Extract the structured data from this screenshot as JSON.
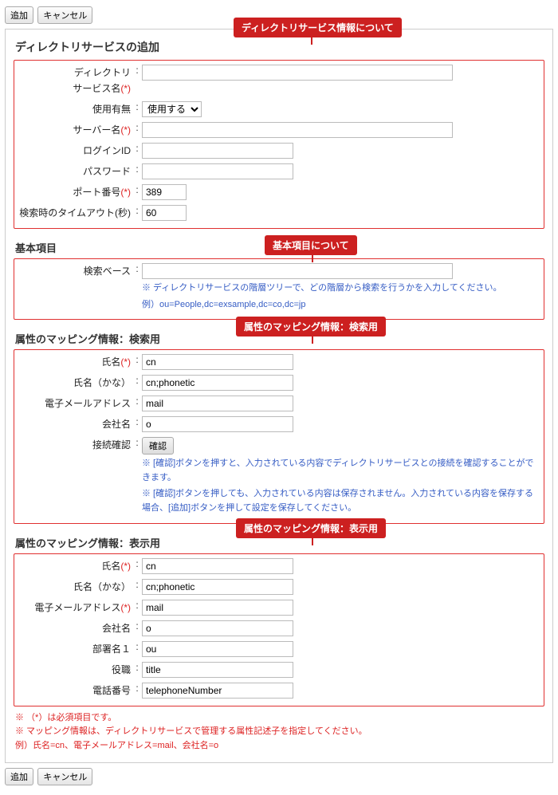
{
  "buttons": {
    "add": "追加",
    "cancel": "キャンセル",
    "confirm": "確認"
  },
  "page_title": "ディレクトリサービスの追加",
  "callouts": {
    "c1": "ディレクトリサービス情報について",
    "c2": "基本項目について",
    "c3": "属性のマッピング情報：検索用",
    "c4": "属性のマッピング情報：表示用"
  },
  "section1": {
    "labels": {
      "dir_name_line1": "ディレクトリ",
      "dir_name_line2": "サービス名",
      "use": "使用有無",
      "server": "サーバー名",
      "login": "ログインID",
      "password": "パスワード",
      "port": "ポート番号",
      "timeout": "検索時のタイムアウト(秒)"
    },
    "values": {
      "dir_name": "",
      "use_selected": "使用する",
      "server": "",
      "login": "",
      "password": "",
      "port": "389",
      "timeout": "60"
    }
  },
  "section2": {
    "title": "基本項目",
    "labels": {
      "base": "検索ベース"
    },
    "values": {
      "base": ""
    },
    "help1": "※ ディレクトリサービスの階層ツリーで、どの階層から検索を行うかを入力してください。",
    "help2": "例）ou=People,dc=exsample,dc=co,dc=jp"
  },
  "section3": {
    "title": "属性のマッピング情報：検索用",
    "labels": {
      "name": "氏名",
      "kana": "氏名（かな）",
      "email": "電子メールアドレス",
      "company": "会社名",
      "conn": "接続確認"
    },
    "values": {
      "name": "cn",
      "kana": "cn;phonetic",
      "email": "mail",
      "company": "o"
    },
    "help1": "※ [確認]ボタンを押すと、入力されている内容でディレクトリサービスとの接続を確認することができます。",
    "help2": "※ [確認]ボタンを押しても、入力されている内容は保存されません。入力されている内容を保存する場合、[追加]ボタンを押して設定を保存してください。"
  },
  "section4": {
    "title": "属性のマッピング情報：表示用",
    "labels": {
      "name": "氏名",
      "kana": "氏名（かな）",
      "email": "電子メールアドレス",
      "company": "会社名",
      "dept": "部署名１",
      "role": "役職",
      "tel": "電話番号"
    },
    "values": {
      "name": "cn",
      "kana": "cn;phonetic",
      "email": "mail",
      "company": "o",
      "dept": "ou",
      "role": "title",
      "tel": "telephoneNumber"
    }
  },
  "footer": {
    "l1": "※ （*）は必須項目です。",
    "l2": "※ マッピング情報は、ディレクトリサービスで管理する属性記述子を指定してください。",
    "l3": "例）氏名=cn、電子メールアドレス=mail、会社名=o"
  },
  "req_mark": "(*)"
}
